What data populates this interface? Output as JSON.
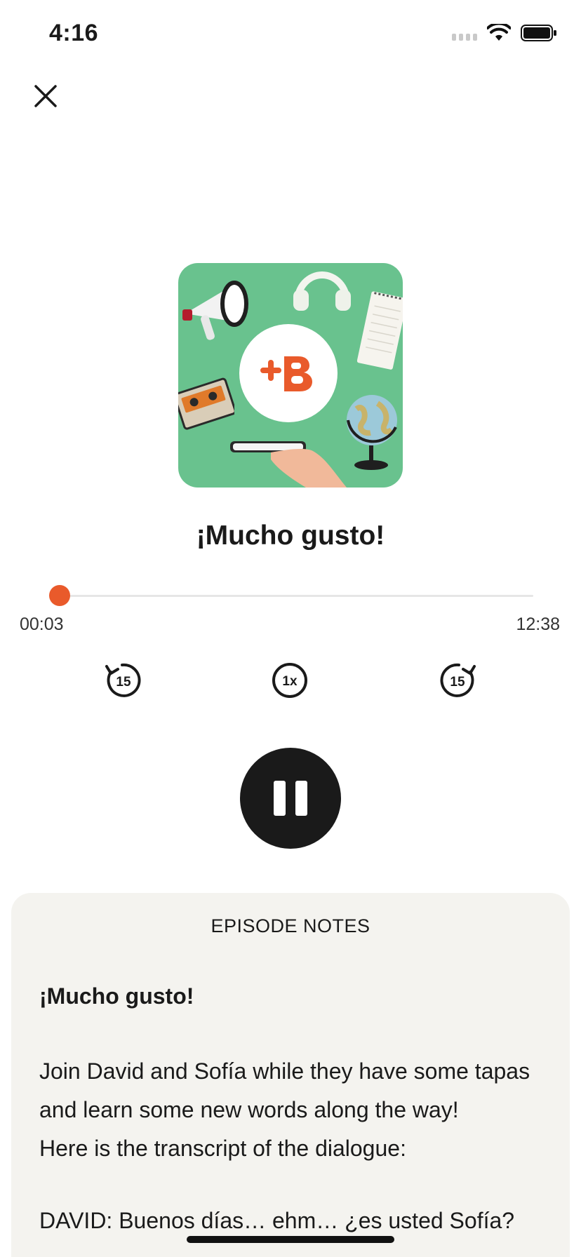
{
  "status_bar": {
    "time": "4:16"
  },
  "player": {
    "close_icon": "close-icon",
    "artwork": {
      "background_color": "#69c28e",
      "logo_text": "+B",
      "logo_color": "#e95a2b"
    },
    "episode_title": "¡Mucho gusto!",
    "progress": {
      "elapsed": "00:03",
      "total": "12:38",
      "fraction": 0.004
    },
    "controls": {
      "rewind_label": "15",
      "speed_label": "1x",
      "forward_label": "15"
    },
    "accent_color": "#e95a2b"
  },
  "notes": {
    "heading": "EPISODE NOTES",
    "title": "¡Mucho gusto!",
    "line1": "Join David and Sofía while they have some tapas and learn some new words along the way!",
    "line2": "Here is the transcript of the dialogue:",
    "line3": "DAVID: Buenos días… ehm… ¿es usted Sofía?"
  }
}
